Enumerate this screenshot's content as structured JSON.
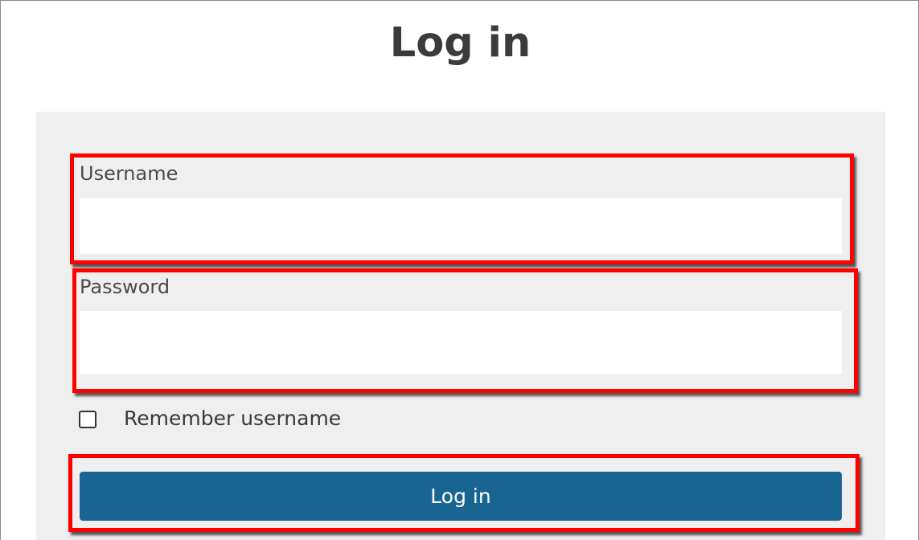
{
  "page": {
    "title": "Log in"
  },
  "form": {
    "username_label": "Username",
    "username_value": "",
    "password_label": "Password",
    "password_value": "",
    "remember_label": "Remember username",
    "remember_checked": false,
    "submit_label": "Log in"
  },
  "colors": {
    "panel_background": "#efefef",
    "button_background": "#186591",
    "highlight_border": "#ff0000",
    "title_text": "#3b3b3b"
  }
}
